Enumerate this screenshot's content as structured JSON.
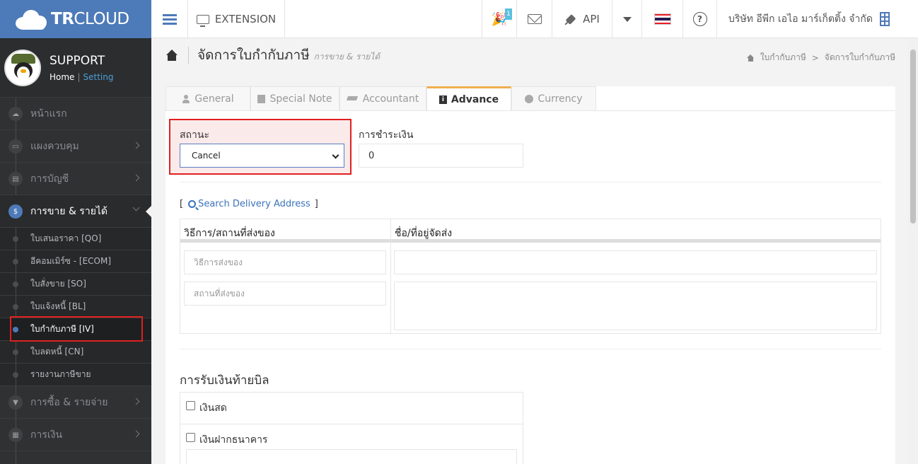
{
  "brand": {
    "name_bold": "TR",
    "name_light": "CLOUD"
  },
  "topbar": {
    "extension_label": "EXTENSION",
    "notification_count": "1",
    "api_label": "API",
    "help_label": "?",
    "company_name": "บริษัท อีพีก เอไอ มาร์เก็ตติ้ง จำกัด",
    "flag_colors": [
      "#ed1c24",
      "#ffffff",
      "#241d4f",
      "#ffffff",
      "#ed1c24"
    ]
  },
  "sidebar": {
    "profile_name": "SUPPORT",
    "home_link": "Home",
    "setting_link": "Setting",
    "items": [
      {
        "label": "หน้าแรก",
        "icon": "cloud-icon",
        "glyph": "☁"
      },
      {
        "label": "แผงควบคุม",
        "icon": "monitor-icon",
        "glyph": "▭"
      },
      {
        "label": "การบัญชี",
        "icon": "book-icon",
        "glyph": "▤"
      },
      {
        "label": "การขาย & รายได้",
        "icon": "dollar-icon",
        "glyph": "$"
      },
      {
        "label": "การซื้อ & รายจ่าย",
        "icon": "cart-icon",
        "glyph": "▼"
      },
      {
        "label": "การเงิน",
        "icon": "calendar-icon",
        "glyph": "▦"
      }
    ],
    "submenu": [
      "ใบเสนอราคา [QO]",
      "อีคอมเมิร์ซ - [ECOM]",
      "ใบสั่งขาย [SO]",
      "ใบแจ้งหนี้ [BL]",
      "ใบกำกับภาษี [IV]",
      "ใบลดหนี้ [CN]",
      "รายงานภาษีขาย"
    ]
  },
  "page": {
    "title": "จัดการใบกำกับภาษี",
    "subtitle": "การขาย & รายได้",
    "breadcrumb": [
      "ใบกำกับภาษี",
      "จัดการใบกำกับภาษี"
    ],
    "breadcrumb_sep": ">"
  },
  "tabs": [
    {
      "label": "General",
      "icon": "user-icon"
    },
    {
      "label": "Special Note",
      "icon": "note-icon"
    },
    {
      "label": "Accountant",
      "icon": "graduation-cap-icon"
    },
    {
      "label": "Advance",
      "icon": "info-icon"
    },
    {
      "label": "Currency",
      "icon": "globe-icon"
    }
  ],
  "form": {
    "status_label": "สถานะ",
    "status_value": "Cancel",
    "payment_label": "การชำระเงิน",
    "payment_value": "0",
    "search_delivery_open": "[",
    "search_delivery_label": "Search Delivery Address",
    "search_delivery_close": "]",
    "delivery_headers": [
      "วิธีการ/สถานที่ส่งของ",
      "ชื่อ/ที่อยู่จัดส่ง"
    ],
    "delivery_method_placeholder": "วิธีการส่งของ",
    "delivery_place_placeholder": "สถานที่ส่งของ",
    "receipt_heading": "การรับเงินท้ายบิล",
    "cash_label": "เงินสด",
    "bank_label": "เงินฝากธนาคาร"
  }
}
